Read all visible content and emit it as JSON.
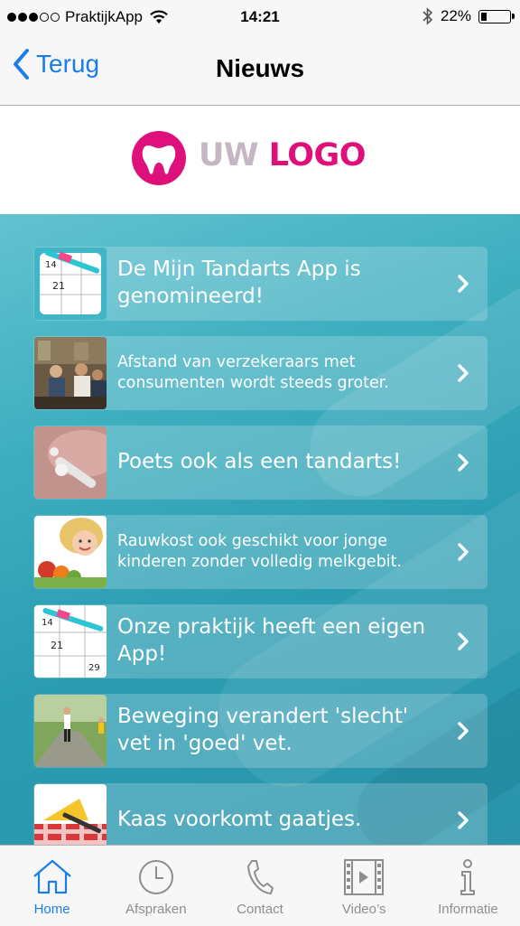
{
  "status_bar": {
    "carrier": "PraktijkApp",
    "time": "14:21",
    "battery": "22%",
    "battery_level": 0.22
  },
  "nav": {
    "back_label": "Terug",
    "title": "Nieuws"
  },
  "logo": {
    "part1": "UW",
    "part2": "LOGO"
  },
  "news": [
    {
      "title": "De Mijn Tandarts App is genomineerd!",
      "thumb": "calendar-toothbrush-image"
    },
    {
      "title": "Afstand van verzekeraars met consumenten wordt steeds groter.",
      "thumb": "cafe-people-image"
    },
    {
      "title": "Poets ook als een tandarts!",
      "thumb": "dental-tool-image"
    },
    {
      "title": "Rauwkost ook geschikt voor jonge kinderen zonder volledig melkgebit.",
      "thumb": "child-vegetables-image"
    },
    {
      "title": "Onze praktijk heeft een eigen App!",
      "thumb": "calendar-toothbrush-image"
    },
    {
      "title": "Beweging verandert 'slecht' vet in 'goed' vet.",
      "thumb": "runner-image"
    },
    {
      "title": "Kaas voorkomt gaatjes.",
      "thumb": "cheese-image"
    }
  ],
  "tabs": [
    {
      "label": "Home",
      "icon": "home-icon",
      "active": true
    },
    {
      "label": "Afspraken",
      "icon": "clock-icon",
      "active": false
    },
    {
      "label": "Contact",
      "icon": "phone-icon",
      "active": false
    },
    {
      "label": "Video’s",
      "icon": "film-icon",
      "active": false
    },
    {
      "label": "Informatie",
      "icon": "info-icon",
      "active": false
    }
  ],
  "colors": {
    "accent": "#1a7de8",
    "brand": "#df0f7c",
    "logo_grey": "#c4b6c2",
    "background": "#3eaebf"
  }
}
